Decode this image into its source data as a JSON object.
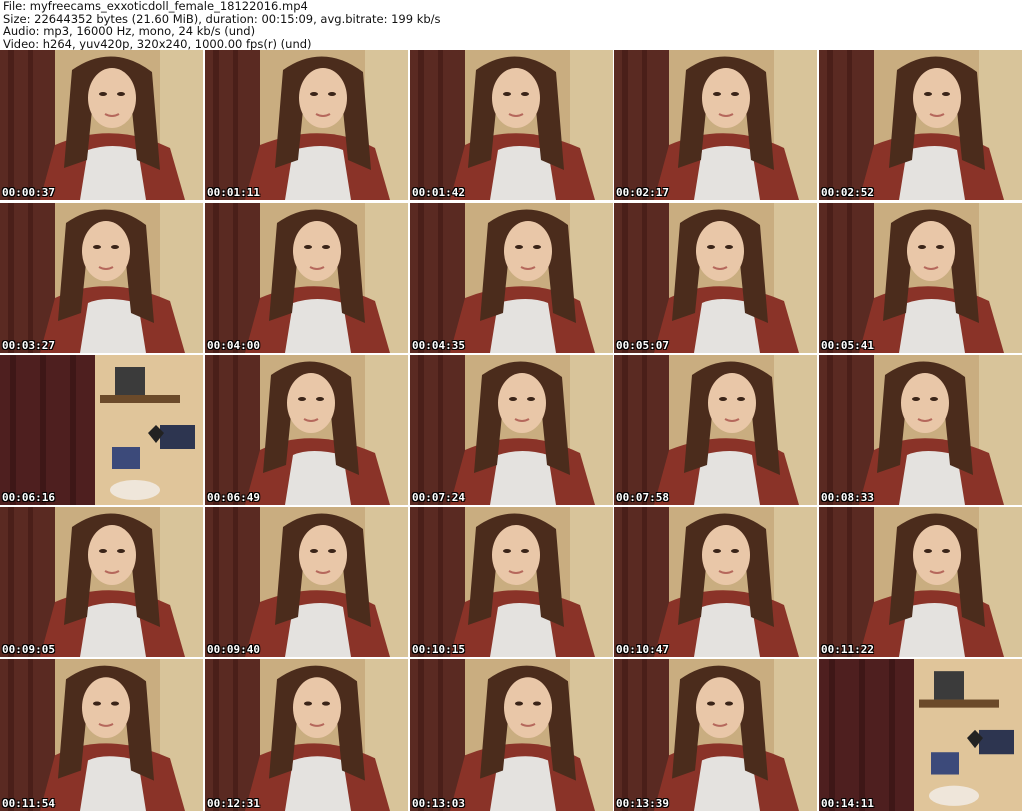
{
  "header": {
    "file_line": "File: myfreecams_exxoticdoll_female_18122016.mp4",
    "size_line": "Size: 22644352 bytes (21.60 MiB), duration: 00:15:09, avg.bitrate: 199 kb/s",
    "audio_line": "Audio: mp3, 16000 Hz, mono, 24 kb/s (und)",
    "video_line": "Video: h264, yuv420p, 320x240, 1000.00 fps(r) (und)"
  },
  "thumbnails": [
    {
      "time": "00:00:37",
      "scene": "person"
    },
    {
      "time": "00:01:11",
      "scene": "person"
    },
    {
      "time": "00:01:42",
      "scene": "person"
    },
    {
      "time": "00:02:17",
      "scene": "person"
    },
    {
      "time": "00:02:52",
      "scene": "person"
    },
    {
      "time": "00:03:27",
      "scene": "person"
    },
    {
      "time": "00:04:00",
      "scene": "person"
    },
    {
      "time": "00:04:35",
      "scene": "person"
    },
    {
      "time": "00:05:07",
      "scene": "person"
    },
    {
      "time": "00:05:41",
      "scene": "person"
    },
    {
      "time": "00:06:16",
      "scene": "room"
    },
    {
      "time": "00:06:49",
      "scene": "person"
    },
    {
      "time": "00:07:24",
      "scene": "person"
    },
    {
      "time": "00:07:58",
      "scene": "person"
    },
    {
      "time": "00:08:33",
      "scene": "person"
    },
    {
      "time": "00:09:05",
      "scene": "person"
    },
    {
      "time": "00:09:40",
      "scene": "person"
    },
    {
      "time": "00:10:15",
      "scene": "person"
    },
    {
      "time": "00:10:47",
      "scene": "person"
    },
    {
      "time": "00:11:22",
      "scene": "person"
    },
    {
      "time": "00:11:54",
      "scene": "person"
    },
    {
      "time": "00:12:31",
      "scene": "person"
    },
    {
      "time": "00:13:03",
      "scene": "person"
    },
    {
      "time": "00:13:39",
      "scene": "person"
    },
    {
      "time": "00:14:11",
      "scene": "room"
    }
  ]
}
